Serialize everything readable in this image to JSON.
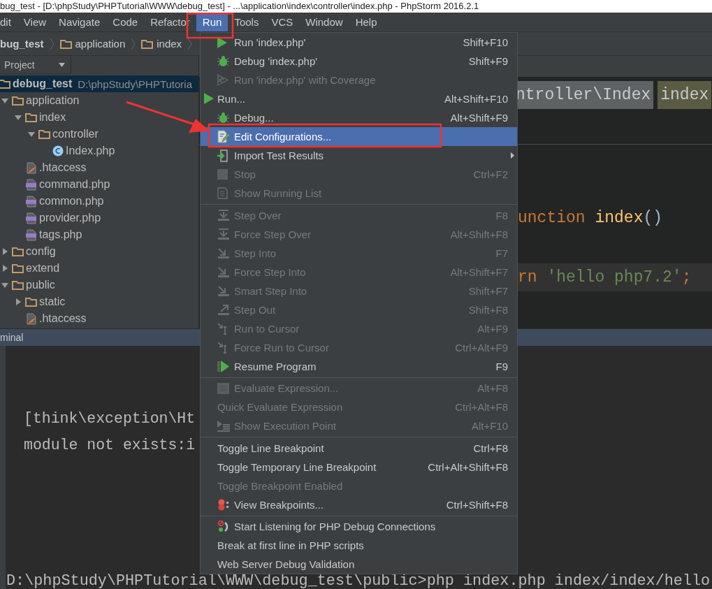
{
  "window": {
    "title": "bug_test - [D:\\phpStudy\\PHPTutorial\\WWW\\debug_test] - ...\\application\\index\\controller\\index.php - PhpStorm 2016.2.1"
  },
  "menu_bar": [
    {
      "label": "dit",
      "selected": false
    },
    {
      "label": "View",
      "selected": false
    },
    {
      "label": "Navigate",
      "selected": false
    },
    {
      "label": "Code",
      "selected": false
    },
    {
      "label": "Refactor",
      "selected": false
    },
    {
      "label": "Run",
      "selected": true
    },
    {
      "label": "Tools",
      "selected": false
    },
    {
      "label": "VCS",
      "selected": false
    },
    {
      "label": "Window",
      "selected": false
    },
    {
      "label": "Help",
      "selected": false
    }
  ],
  "navigation_bar": [
    {
      "label": "bug_test",
      "kind": "project"
    },
    {
      "label": "application",
      "kind": "folder"
    },
    {
      "label": "index",
      "kind": "folder"
    }
  ],
  "project": {
    "title": "Project",
    "tree": [
      {
        "name": "debug_test",
        "kind": "project",
        "path": "D:\\phpStudy\\PHPTutoria",
        "selected": true,
        "children": [
          {
            "name": "application",
            "kind": "folder",
            "expanded": true,
            "selected": false,
            "children": [
              {
                "name": "index",
                "kind": "folder",
                "expanded": true,
                "selected": false,
                "children": [
                  {
                    "name": "controller",
                    "kind": "folder",
                    "expanded": true,
                    "selected": false,
                    "children": [
                      {
                        "name": "Index.php",
                        "kind": "class",
                        "selected": false
                      }
                    ]
                  }
                ]
              },
              {
                "name": ".htaccess",
                "kind": "htaccess",
                "selected": false
              },
              {
                "name": "command.php",
                "kind": "php",
                "selected": false
              },
              {
                "name": "common.php",
                "kind": "php",
                "selected": false
              },
              {
                "name": "provider.php",
                "kind": "php",
                "selected": false
              },
              {
                "name": "tags.php",
                "kind": "php",
                "selected": false
              }
            ]
          },
          {
            "name": "config",
            "kind": "folder",
            "expanded": false,
            "selected": false
          },
          {
            "name": "extend",
            "kind": "folder",
            "expanded": false,
            "selected": false
          },
          {
            "name": "public",
            "kind": "folder",
            "expanded": true,
            "selected": false,
            "children": [
              {
                "name": "static",
                "kind": "folder",
                "expanded": false,
                "selected": false
              },
              {
                "name": ".htaccess",
                "kind": "htaccess",
                "selected": false
              }
            ]
          }
        ]
      }
    ]
  },
  "editor": {
    "breadcrumbs": [
      {
        "label": "ntroller\\Index",
        "kind": "class"
      },
      {
        "label": "index",
        "kind": "method"
      }
    ],
    "lines": [
      {
        "highlighted": false,
        "segments": [
          {
            "text": "unction",
            "kind": "keyword"
          },
          {
            "text": " index",
            "kind": "name"
          },
          {
            "text": "()",
            "kind": "paren"
          }
        ]
      },
      {
        "highlighted": true,
        "segments": [
          {
            "text": "rn",
            "kind": "keyword"
          },
          {
            "text": " 'hello php7.2'",
            "kind": "string"
          },
          {
            "text": ";",
            "kind": "keyword"
          }
        ]
      }
    ]
  },
  "terminal": {
    "title": "minal",
    "output": [
      "[think\\exception\\Ht",
      "module not exists:i"
    ],
    "prompt": "D:\\phpStudy\\PHPTutorial\\WWW\\debug_test\\public>php index.php index/index/hello"
  },
  "run_menu": {
    "groups": [
      {
        "items": [
          {
            "label": "Run 'index.php'",
            "shortcut": "Shift+F10",
            "kind": "run",
            "disabled": false,
            "selected": false,
            "submenu": false
          },
          {
            "label": "Debug 'index.php'",
            "shortcut": "Shift+F9",
            "kind": "debug",
            "disabled": false,
            "selected": false,
            "submenu": false
          },
          {
            "label": "Run 'index.php' with Coverage",
            "kind": "coverage",
            "disabled": true,
            "selected": false,
            "submenu": false
          },
          {
            "label": "Run...",
            "shortcut": "Alt+Shift+F10",
            "kind": "gutter",
            "disabled": false,
            "selected": false,
            "submenu": false
          },
          {
            "label": "Debug...",
            "shortcut": "Alt+Shift+F9",
            "kind": "debug",
            "disabled": false,
            "selected": false,
            "submenu": false
          },
          {
            "label": "Edit Configurations...",
            "kind": "edit",
            "disabled": false,
            "selected": true,
            "submenu": false
          },
          {
            "label": "Import Test Results",
            "kind": "import",
            "disabled": false,
            "selected": false,
            "submenu": true
          },
          {
            "label": "Stop",
            "shortcut": "Ctrl+F2",
            "kind": "stop",
            "disabled": true,
            "selected": false,
            "submenu": false
          },
          {
            "label": "Show Running List",
            "kind": "list",
            "disabled": true,
            "selected": false,
            "submenu": false
          }
        ]
      },
      {
        "items": [
          {
            "label": "Step Over",
            "shortcut": "F8",
            "kind": "stepover",
            "disabled": true,
            "selected": false,
            "submenu": false
          },
          {
            "label": "Force Step Over",
            "shortcut": "Alt+Shift+F8",
            "kind": "stepover",
            "disabled": true,
            "selected": false,
            "submenu": false
          },
          {
            "label": "Step Into",
            "shortcut": "F7",
            "kind": "stepinto",
            "disabled": true,
            "selected": false,
            "submenu": false
          },
          {
            "label": "Force Step Into",
            "shortcut": "Alt+Shift+F7",
            "kind": "stepinto",
            "disabled": true,
            "selected": false,
            "submenu": false
          },
          {
            "label": "Smart Step Into",
            "shortcut": "Shift+F7",
            "kind": "stepinto",
            "disabled": true,
            "selected": false,
            "submenu": false
          },
          {
            "label": "Step Out",
            "shortcut": "Shift+F8",
            "kind": "stepout",
            "disabled": true,
            "selected": false,
            "submenu": false
          },
          {
            "label": "Run to Cursor",
            "shortcut": "Alt+F9",
            "kind": "cursor",
            "disabled": true,
            "selected": false,
            "submenu": false
          },
          {
            "label": "Force Run to Cursor",
            "shortcut": "Ctrl+Alt+F9",
            "kind": "cursor",
            "disabled": true,
            "selected": false,
            "submenu": false
          },
          {
            "label": "Resume Program",
            "shortcut": "F9",
            "kind": "resume",
            "disabled": false,
            "selected": false,
            "submenu": false
          }
        ]
      },
      {
        "items": [
          {
            "label": "Evaluate Expression...",
            "shortcut": "Alt+F8",
            "kind": "evaluate",
            "disabled": true,
            "selected": false,
            "submenu": false
          },
          {
            "label": "Quick Evaluate Expression",
            "shortcut": "Ctrl+Alt+F8",
            "kind": "text",
            "disabled": true,
            "selected": false,
            "submenu": false
          },
          {
            "label": "Show Execution Point",
            "shortcut": "Alt+F10",
            "kind": "execpoint",
            "disabled": true,
            "selected": false,
            "submenu": false
          }
        ]
      },
      {
        "items": [
          {
            "label": "Toggle Line Breakpoint",
            "shortcut": "Ctrl+F8",
            "kind": "text",
            "disabled": false,
            "selected": false,
            "submenu": false
          },
          {
            "label": "Toggle Temporary Line Breakpoint",
            "shortcut": "Ctrl+Alt+Shift+F8",
            "kind": "text",
            "disabled": false,
            "selected": false,
            "submenu": false
          },
          {
            "label": "Toggle Breakpoint Enabled",
            "kind": "text",
            "disabled": true,
            "selected": false,
            "submenu": false
          },
          {
            "label": "View Breakpoints...",
            "shortcut": "Ctrl+Shift+F8",
            "kind": "breakpoints",
            "disabled": false,
            "selected": false,
            "submenu": false
          }
        ]
      },
      {
        "items": [
          {
            "label": "Start Listening for PHP Debug Connections",
            "kind": "listen",
            "disabled": false,
            "selected": false,
            "submenu": false
          },
          {
            "label": "Break at first line in PHP scripts",
            "kind": "text",
            "disabled": false,
            "selected": false,
            "submenu": false
          },
          {
            "label": "Web Server Debug Validation",
            "kind": "text",
            "disabled": false,
            "selected": false,
            "submenu": false
          }
        ]
      }
    ]
  }
}
